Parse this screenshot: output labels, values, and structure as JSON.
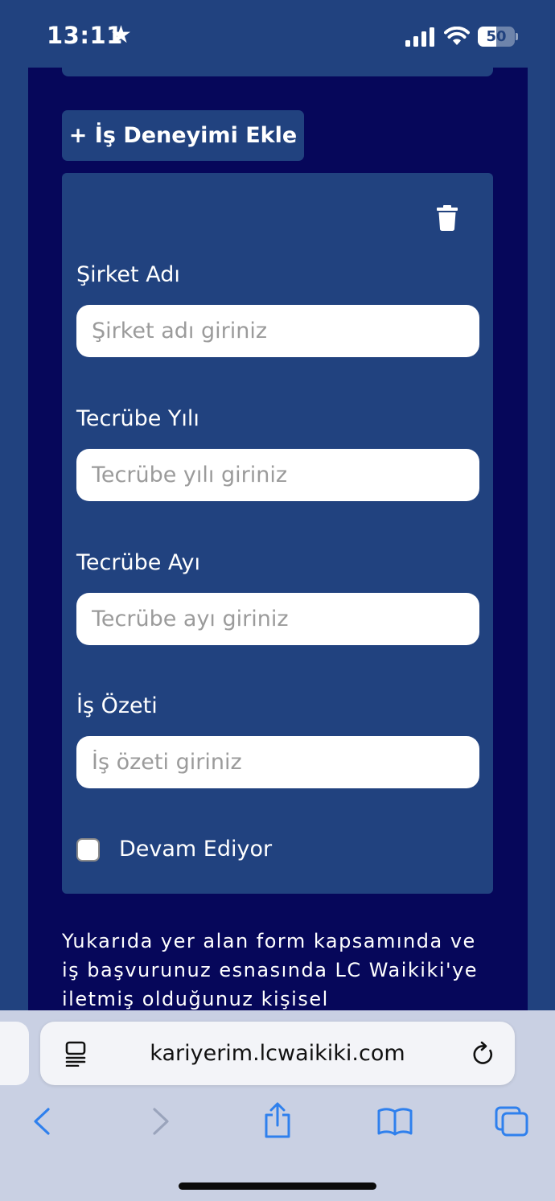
{
  "status_bar": {
    "time": "13:11",
    "battery_level": "50",
    "battery_fraction": 0.5,
    "text_color": "#ffffff"
  },
  "form": {
    "add_experience_button": "+ İş Deneyimi Ekle",
    "delete_icon": "trash-icon",
    "fields": [
      {
        "label": "Şirket Adı",
        "placeholder": "Şirket adı giriniz",
        "value": ""
      },
      {
        "label": "Tecrübe Yılı",
        "placeholder": "Tecrübe yılı giriniz",
        "value": ""
      },
      {
        "label": "Tecrübe Ayı",
        "placeholder": "Tecrübe ayı giriniz",
        "value": ""
      },
      {
        "label": "İş Özeti",
        "placeholder": "İş özeti giriniz",
        "value": ""
      }
    ],
    "ongoing_checkbox": {
      "label": "Devam Ediyor",
      "checked": false
    }
  },
  "consent": {
    "text": "Yukarıda yer alan form kapsamında ve iş başvurunuz esnasında LC Waikiki'ye iletmiş olduğunuz kişisel"
  },
  "browser": {
    "url": "kariyerim.lcwaikiki.com",
    "icons": [
      "reader-icon",
      "reload-icon",
      "back-icon",
      "forward-icon",
      "share-icon",
      "bookmarks-icon",
      "tabs-icon"
    ]
  },
  "colors": {
    "page_background": "#21427f",
    "panel_background": "#06075a",
    "card_background": "#21427f",
    "browser_chrome": "#c9d0e3",
    "accent_blue": "#2f80ed"
  }
}
